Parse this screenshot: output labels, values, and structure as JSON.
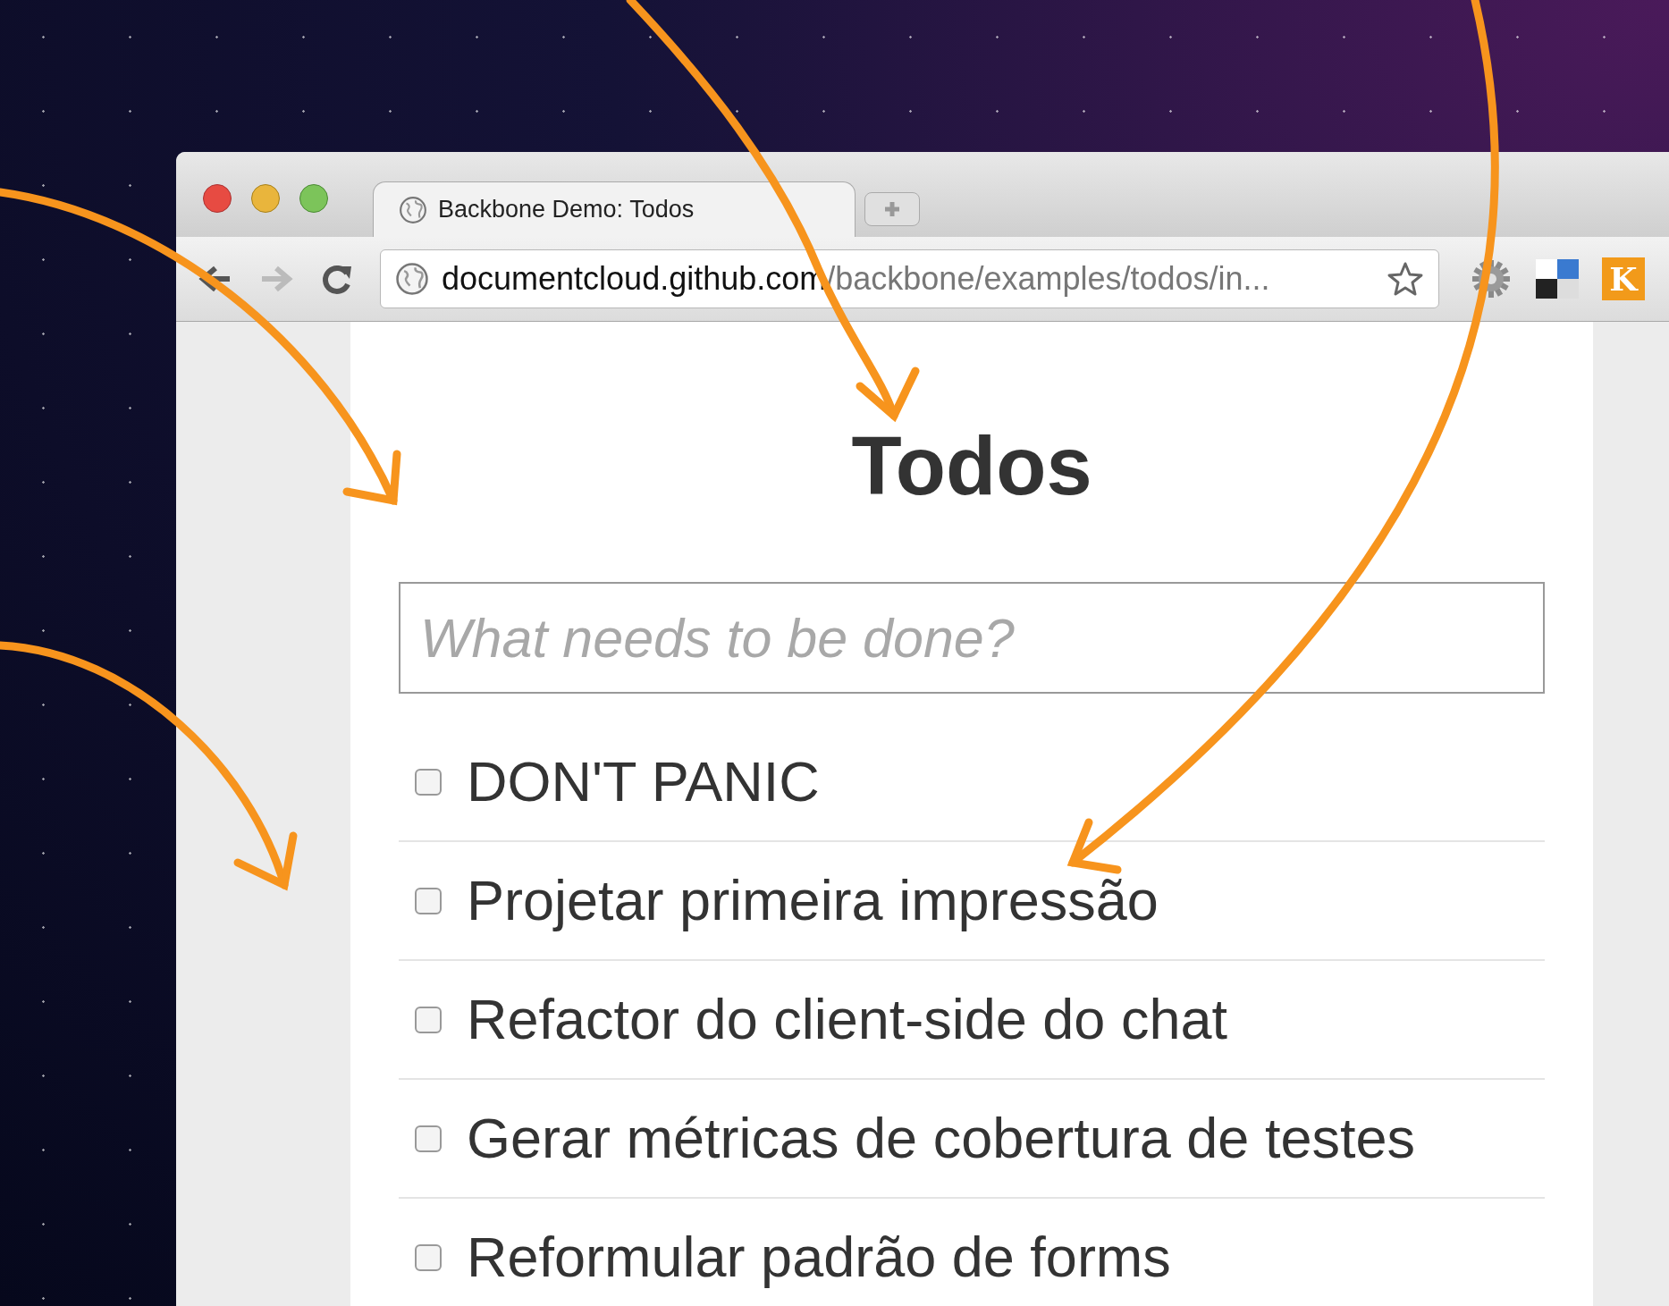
{
  "tab": {
    "title": "Backbone Demo: Todos",
    "selected": true
  },
  "address_bar": {
    "domain": "documentcloud.github.com",
    "path": "/backbone/examples/todos/in..."
  },
  "app": {
    "title": "Todos",
    "new_todo": {
      "placeholder": "What needs to be done?"
    },
    "todos": [
      {
        "text": "DON'T PANIC",
        "checked": false
      },
      {
        "text": "Projetar primeira impressão",
        "checked": false
      },
      {
        "text": "Refactor do client-side do chat",
        "checked": false
      },
      {
        "text": "Gerar métricas de cobertura de testes",
        "checked": false
      },
      {
        "text": "Reformular padrão de forms",
        "checked": false
      }
    ]
  },
  "extensions": [
    {
      "kind": "gear"
    },
    {
      "kind": "squares"
    },
    {
      "kind": "letter",
      "label": "K"
    }
  ]
}
